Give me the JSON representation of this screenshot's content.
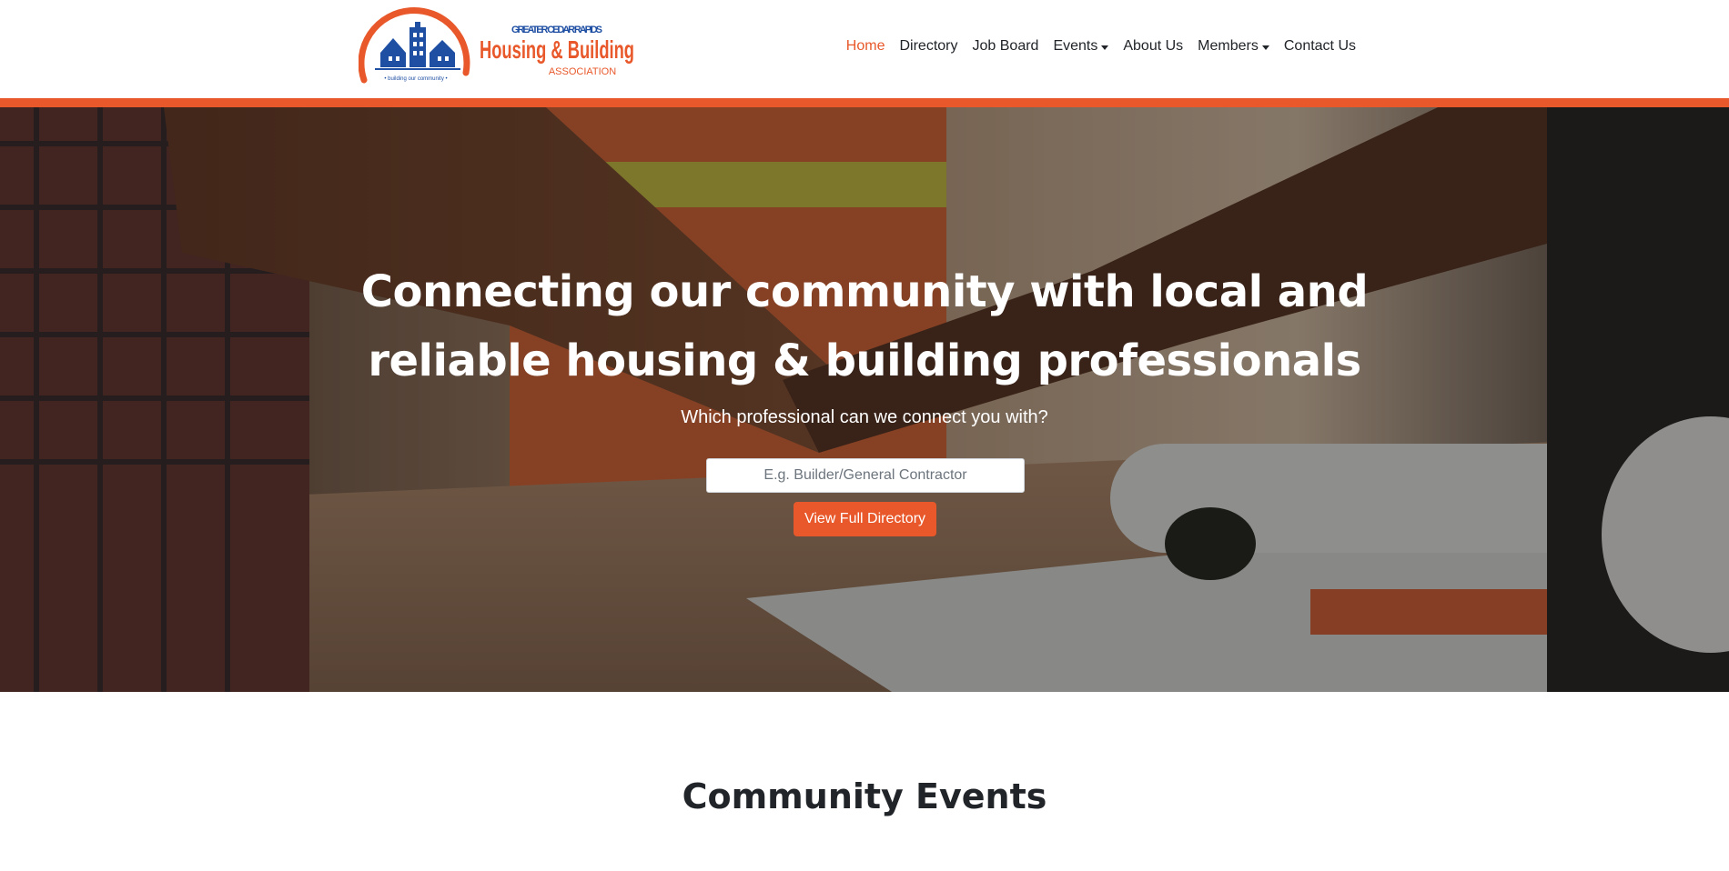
{
  "header": {
    "logo": {
      "line1": "GREATER CEDAR RAPIDS",
      "line2": "Housing & Building",
      "line3": "ASSOCIATION",
      "tagline": "• building our community •"
    },
    "nav": [
      {
        "label": "Home",
        "active": true
      },
      {
        "label": "Directory"
      },
      {
        "label": "Job Board"
      },
      {
        "label": "Events",
        "dropdown": true
      },
      {
        "label": "About Us"
      },
      {
        "label": "Members",
        "dropdown": true
      },
      {
        "label": "Contact Us"
      }
    ]
  },
  "hero": {
    "title": "Connecting our community with local and reliable housing & building professionals",
    "subtitle": "Which professional can we connect you with?",
    "search_placeholder": "E.g. Builder/General Contractor",
    "search_value": "",
    "button_label": "View Full Directory"
  },
  "events": {
    "title": "Community Events"
  },
  "colors": {
    "accent": "#e8582a",
    "brand_blue": "#1f4fa3",
    "text": "#212529"
  }
}
